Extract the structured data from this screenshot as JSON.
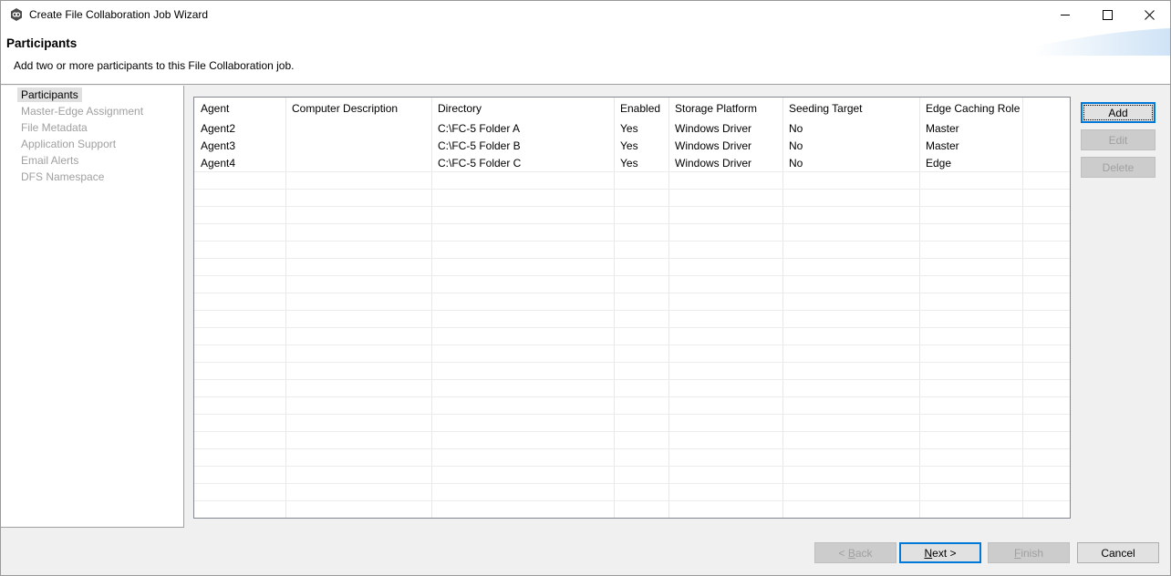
{
  "window": {
    "title": "Create File Collaboration Job Wizard",
    "controls": {
      "minimize": "—",
      "maximize": "☐",
      "close": "✕"
    }
  },
  "header": {
    "title": "Participants",
    "subtitle": "Add two or more participants to this File Collaboration job."
  },
  "nav": {
    "items": [
      {
        "label": "Participants",
        "selected": true
      },
      {
        "label": "Master-Edge Assignment",
        "selected": false
      },
      {
        "label": "File Metadata",
        "selected": false
      },
      {
        "label": "Application Support",
        "selected": false
      },
      {
        "label": "Email Alerts",
        "selected": false
      },
      {
        "label": "DFS Namespace",
        "selected": false
      }
    ]
  },
  "table": {
    "columns": [
      "Agent",
      "Computer Description",
      "Directory",
      "Enabled",
      "Storage Platform",
      "Seeding Target",
      "Edge Caching Role"
    ],
    "rows": [
      [
        "Agent2",
        "",
        "C:\\FC-5 Folder A",
        "Yes",
        "Windows Driver",
        "No",
        "Master"
      ],
      [
        "Agent3",
        "",
        "C:\\FC-5 Folder B",
        "Yes",
        "Windows Driver",
        "No",
        "Master"
      ],
      [
        "Agent4",
        "",
        "C:\\FC-5 Folder C",
        "Yes",
        "Windows Driver",
        "No",
        "Edge"
      ]
    ]
  },
  "side_buttons": {
    "add": "Add",
    "edit": "Edit",
    "delete": "Delete"
  },
  "footer_buttons": {
    "back_prefix": "< ",
    "back_key": "B",
    "back_rest": "ack",
    "next_key": "N",
    "next_rest": "ext >",
    "finish_key": "F",
    "finish_rest": "inish",
    "cancel": "Cancel"
  },
  "colors": {
    "default_button_border": "#0078d7",
    "disabled_text": "#a0a0a0",
    "selected_nav_bg": "#e0e0e0"
  }
}
